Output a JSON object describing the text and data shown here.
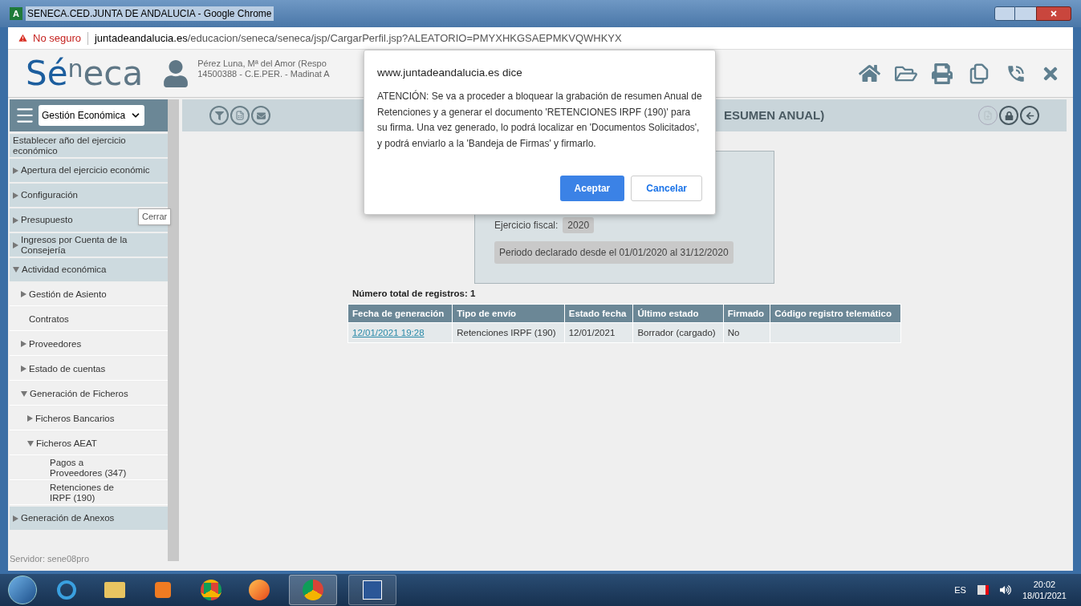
{
  "window": {
    "favicon_letter": "A",
    "title": "SENECA.CED.JUNTA DE ANDALUCIA - Google Chrome"
  },
  "address_bar": {
    "security": "No seguro",
    "url_host": "juntadeandalucia.es",
    "url_path": "/educacion/seneca/seneca/jsp/CargarPerfil.jsp?ALEATORIO=PMYXHKGSAEPMKVQWHKYX"
  },
  "header": {
    "logo": {
      "primary": "Sé",
      "raised": "n",
      "secondary": "eca"
    },
    "user_name": "Pérez Luna, Mª del Amor (Respo",
    "user_center": "14500388 - C.E.PER. - Madinat A"
  },
  "sidebar": {
    "module_select": "Gestión Económica",
    "tooltip": "Cerrar",
    "server": "Servidor: sene08pro",
    "items": [
      {
        "label": "Establecer año del ejercicio económico",
        "kind": "leaf"
      },
      {
        "label": "Apertura del ejercicio económic",
        "kind": "folder",
        "expanded": false
      },
      {
        "label": "Configuración",
        "kind": "folder",
        "expanded": false
      },
      {
        "label": "Presupuesto",
        "kind": "folder",
        "expanded": false
      },
      {
        "label": "Ingresos por Cuenta de la Consejería",
        "kind": "folder",
        "expanded": false
      },
      {
        "label": "Actividad económica",
        "kind": "folder",
        "expanded": true,
        "children": [
          {
            "label": "Gestión de Asiento",
            "kind": "folder",
            "expanded": false
          },
          {
            "label": "Contratos",
            "kind": "leaf"
          },
          {
            "label": "Proveedores",
            "kind": "folder",
            "expanded": false
          },
          {
            "label": "Estado de cuentas",
            "kind": "folder",
            "expanded": false
          },
          {
            "label": "Generación de Ficheros",
            "kind": "folder",
            "expanded": true,
            "children": [
              {
                "label": "Ficheros Bancarios",
                "kind": "folder",
                "expanded": false
              },
              {
                "label": "Ficheros AEAT",
                "kind": "folder",
                "expanded": true,
                "children": [
                  {
                    "label": "Pagos a Proveedores (347)",
                    "kind": "leaf"
                  },
                  {
                    "label": "Retenciones de IRPF (190)",
                    "kind": "leaf"
                  }
                ]
              }
            ]
          }
        ]
      },
      {
        "label": "Generación de Anexos",
        "kind": "folder",
        "expanded": false
      }
    ]
  },
  "content": {
    "title": "ESUMEN ANUAL)",
    "fiscal_label": "Ejercicio fiscal:",
    "fiscal_year": "2020",
    "period": "Periodo declarado desde el 01/01/2020 al 31/12/2020",
    "total": "Número total de registros: 1",
    "table": {
      "columns": [
        "Fecha de generación",
        "Tipo de envío",
        "Estado fecha",
        "Último estado",
        "Firmado",
        "Código registro telemático"
      ],
      "rows": [
        [
          "12/01/2021 19:28",
          "Retenciones IRPF (190)",
          "12/01/2021",
          "Borrador (cargado)",
          "No",
          ""
        ]
      ]
    }
  },
  "dialog": {
    "title": "www.juntadeandalucia.es dice",
    "message": "ATENCIÓN: Se va a proceder a bloquear la grabación de resumen Anual de Retenciones y a generar el documento 'RETENCIONES IRPF (190)' para su firma. Una vez generado, lo podrá localizar en 'Documentos Solicitados', y podrá enviarlo a la 'Bandeja de Firmas' y firmarlo.",
    "buttons": [
      "Aceptar",
      "Cancelar"
    ]
  },
  "taskbar": {
    "language": "ES",
    "time": "20:02",
    "date": "18/01/2021"
  }
}
